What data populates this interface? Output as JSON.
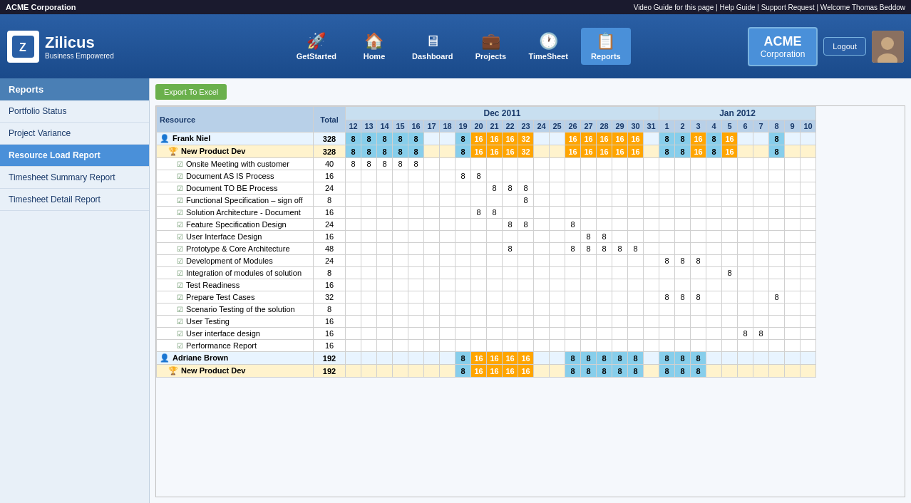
{
  "app": {
    "company": "ACME Corporation",
    "top_links": "Video Guide for this page | Help Guide | Support Request | Welcome Thomas Beddow",
    "logout_label": "Logout"
  },
  "logo": {
    "name": "Zilicus",
    "tagline": "Business Empowered"
  },
  "nav": {
    "items": [
      {
        "label": "GetStarted",
        "icon": "🚀",
        "active": false
      },
      {
        "label": "Home",
        "icon": "🏠",
        "active": false
      },
      {
        "label": "Dashboard",
        "icon": "🖥",
        "active": false
      },
      {
        "label": "Projects",
        "icon": "💼",
        "active": false
      },
      {
        "label": "TimeSheet",
        "icon": "🕐",
        "active": false
      },
      {
        "label": "Reports",
        "icon": "📋",
        "active": true
      }
    ]
  },
  "acme": {
    "name": "ACME",
    "corp": "Corporation"
  },
  "sidebar": {
    "title": "Reports",
    "items": [
      {
        "label": "Portfolio Status",
        "active": false
      },
      {
        "label": "Project Variance",
        "active": false
      },
      {
        "label": "Resource Load Report",
        "active": true
      },
      {
        "label": "Timesheet Summary Report",
        "active": false
      },
      {
        "label": "Timesheet Detail Report",
        "active": false
      }
    ]
  },
  "toolbar": {
    "export_label": "Export To Excel"
  },
  "table": {
    "months": [
      {
        "label": "Dec 2011",
        "span": 14
      },
      {
        "label": "Jan 2012",
        "span": 14
      }
    ],
    "days_dec": [
      "12",
      "13",
      "14",
      "15",
      "16",
      "17",
      "18",
      "19",
      "20",
      "21",
      "22",
      "23",
      "24",
      "25",
      "26",
      "27",
      "28",
      "29",
      "30",
      "31"
    ],
    "days_jan": [
      "1",
      "2",
      "3",
      "4",
      "5",
      "6",
      "7",
      "8",
      "9",
      "10"
    ],
    "col_resource": "Resource",
    "col_total": "Total",
    "rows": [
      {
        "type": "person",
        "name": "Frank Niel",
        "total": "328",
        "days": {
          "12": "8",
          "13": "8",
          "14": "8",
          "15": "8",
          "16": "8",
          "19": "8",
          "20": "16",
          "21": "16",
          "22": "16",
          "23": "32",
          "26": "16",
          "27": "16",
          "28": "16",
          "29": "16",
          "30": "16",
          "j1": "8",
          "j2": "8",
          "j3": "16",
          "j4": "8",
          "j5": "16",
          "j8": "8"
        }
      },
      {
        "type": "project",
        "name": "New Product Dev",
        "total": "328",
        "days": {
          "12": "8",
          "13": "8",
          "14": "8",
          "15": "8",
          "16": "8",
          "19": "8",
          "20": "16",
          "21": "16",
          "22": "16",
          "23": "32",
          "26": "16",
          "27": "16",
          "28": "16",
          "29": "16",
          "30": "16",
          "j1": "8",
          "j2": "8",
          "j3": "16",
          "j4": "8",
          "j5": "16",
          "j8": "8"
        }
      },
      {
        "type": "task",
        "name": "Onsite Meeting with customer",
        "total": "40",
        "days": {
          "12": "8",
          "13": "8",
          "14": "8",
          "15": "8",
          "16": "8"
        }
      },
      {
        "type": "task",
        "name": "Document AS IS Process",
        "total": "16",
        "days": {
          "19": "8",
          "20": "8"
        }
      },
      {
        "type": "task",
        "name": "Document TO BE Process",
        "total": "24",
        "days": {
          "21": "8",
          "22": "8",
          "23": "8"
        }
      },
      {
        "type": "task",
        "name": "Functional Specification – sign off",
        "total": "8",
        "days": {
          "23": "8"
        }
      },
      {
        "type": "task",
        "name": "Solution Architecture - Document",
        "total": "16",
        "days": {
          "20": "8",
          "21": "8"
        }
      },
      {
        "type": "task",
        "name": "Feature Specification Design",
        "total": "24",
        "days": {
          "22": "8",
          "23": "8",
          "26": "8"
        }
      },
      {
        "type": "task",
        "name": "User Interface Design",
        "total": "16",
        "days": {
          "27": "8",
          "28": "8"
        }
      },
      {
        "type": "task",
        "name": "Prototype & Core Architecture",
        "total": "48",
        "days": {
          "22": "8",
          "26": "8",
          "27": "8",
          "28": "8",
          "29": "8",
          "30": "8"
        }
      },
      {
        "type": "task",
        "name": "Development of Modules",
        "total": "24",
        "days": {
          "j1": "8",
          "j2": "8",
          "j3": "8"
        }
      },
      {
        "type": "task",
        "name": "Integration of modules of solution",
        "total": "8",
        "days": {
          "j5": "8"
        }
      },
      {
        "type": "task",
        "name": "Test Readiness",
        "total": "16",
        "days": {}
      },
      {
        "type": "task",
        "name": "Prepare Test Cases",
        "total": "32",
        "days": {
          "j1": "8",
          "j2": "8",
          "j3": "8",
          "j8": "8"
        }
      },
      {
        "type": "task",
        "name": "Scenario Testing of the solution",
        "total": "8",
        "days": {}
      },
      {
        "type": "task",
        "name": "User Testing",
        "total": "16",
        "days": {}
      },
      {
        "type": "task",
        "name": "User interface design",
        "total": "16",
        "days": {
          "j6": "8",
          "j7": "8"
        }
      },
      {
        "type": "task",
        "name": "Performance Report",
        "total": "16",
        "days": {}
      },
      {
        "type": "person",
        "name": "Adriane Brown",
        "total": "192",
        "days": {
          "19": "8",
          "20": "16",
          "21": "16",
          "22": "16",
          "23": "16",
          "26": "8",
          "27": "8",
          "28": "8",
          "29": "8",
          "30": "8",
          "j1": "8",
          "j2": "8",
          "j3": "8"
        }
      },
      {
        "type": "project",
        "name": "New Product Dev",
        "total": "192",
        "days": {
          "19": "8",
          "20": "16",
          "21": "16",
          "22": "16",
          "23": "16",
          "26": "8",
          "27": "8",
          "28": "8",
          "29": "8",
          "30": "8",
          "j1": "8",
          "j2": "8",
          "j3": "8"
        }
      }
    ]
  }
}
